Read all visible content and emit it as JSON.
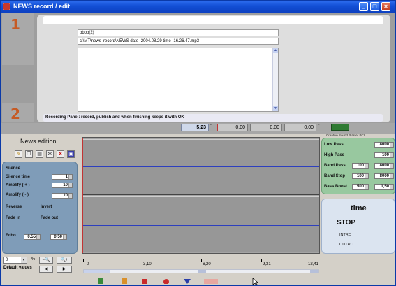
{
  "window": {
    "title": "NEWS record / edit",
    "minimize": "_",
    "maximize": "□",
    "close": "×"
  },
  "steps": [
    "1",
    "2"
  ],
  "record": {
    "name_value": "bbbb(2)",
    "path_value": "c:\\MT\\news_record\\NEWS date- 2004.08.29 time- 16.26.47.mp3",
    "status": "Recording Panel: record, publish and when finishing keeps it with OK"
  },
  "counter": {
    "position": "5,23",
    "values": [
      "0,00",
      "0,00",
      "0,00"
    ],
    "unit": "\"",
    "soundcard_label": "Creative Sound Blaster PCI"
  },
  "news_edition": {
    "title": "News edition",
    "tools": [
      "pencil-icon",
      "copy-icon",
      "paste-icon",
      "cut-icon",
      "delete-icon",
      "disk-icon"
    ]
  },
  "effects": {
    "silence_label": "Silence",
    "silence_time_label": "Silence time",
    "silence_time_value": "1",
    "amplify_plus_label": "Amplify ( + )",
    "amplify_plus_value": "10",
    "amplify_minus_label": "Amplify ( - )",
    "amplify_minus_value": "10",
    "reverse_label": "Reverse",
    "invert_label": "Invert",
    "fade_in_label": "Fade in",
    "fade_out_label": "Fade out",
    "echo_label": "Echo",
    "echo_value1": "0,55",
    "echo_value2": "0,50"
  },
  "filters": {
    "low_pass_label": "Low Pass",
    "low_pass_value": "8000",
    "high_pass_label": "High Pass",
    "high_pass_value": "100",
    "band_pass_label": "Band Pass",
    "band_pass_low": "100",
    "band_pass_high": "8000",
    "band_stop_label": "Band Stop",
    "band_stop_low": "100",
    "band_stop_high": "8000",
    "bass_boost_label": "Bass Boost",
    "bass_boost_value1": "500",
    "bass_boost_value2": "1,50"
  },
  "time_panel": {
    "time_label": "time",
    "state": "STOP",
    "intro_label": "INTRO",
    "outro_label": "OUTRO"
  },
  "bottom": {
    "zoom_value": "0",
    "percent": "%",
    "default_values": "Default values",
    "ruler_labels": [
      "0",
      "3,10",
      "6,20",
      "9,31",
      "12,41"
    ]
  },
  "colors": {
    "step_number": "#c65a24",
    "effects_panel": "#7f9cb8",
    "filters_panel": "#98c89f",
    "waveform_center": "#2d3fbe",
    "cursor": "#c23434"
  }
}
